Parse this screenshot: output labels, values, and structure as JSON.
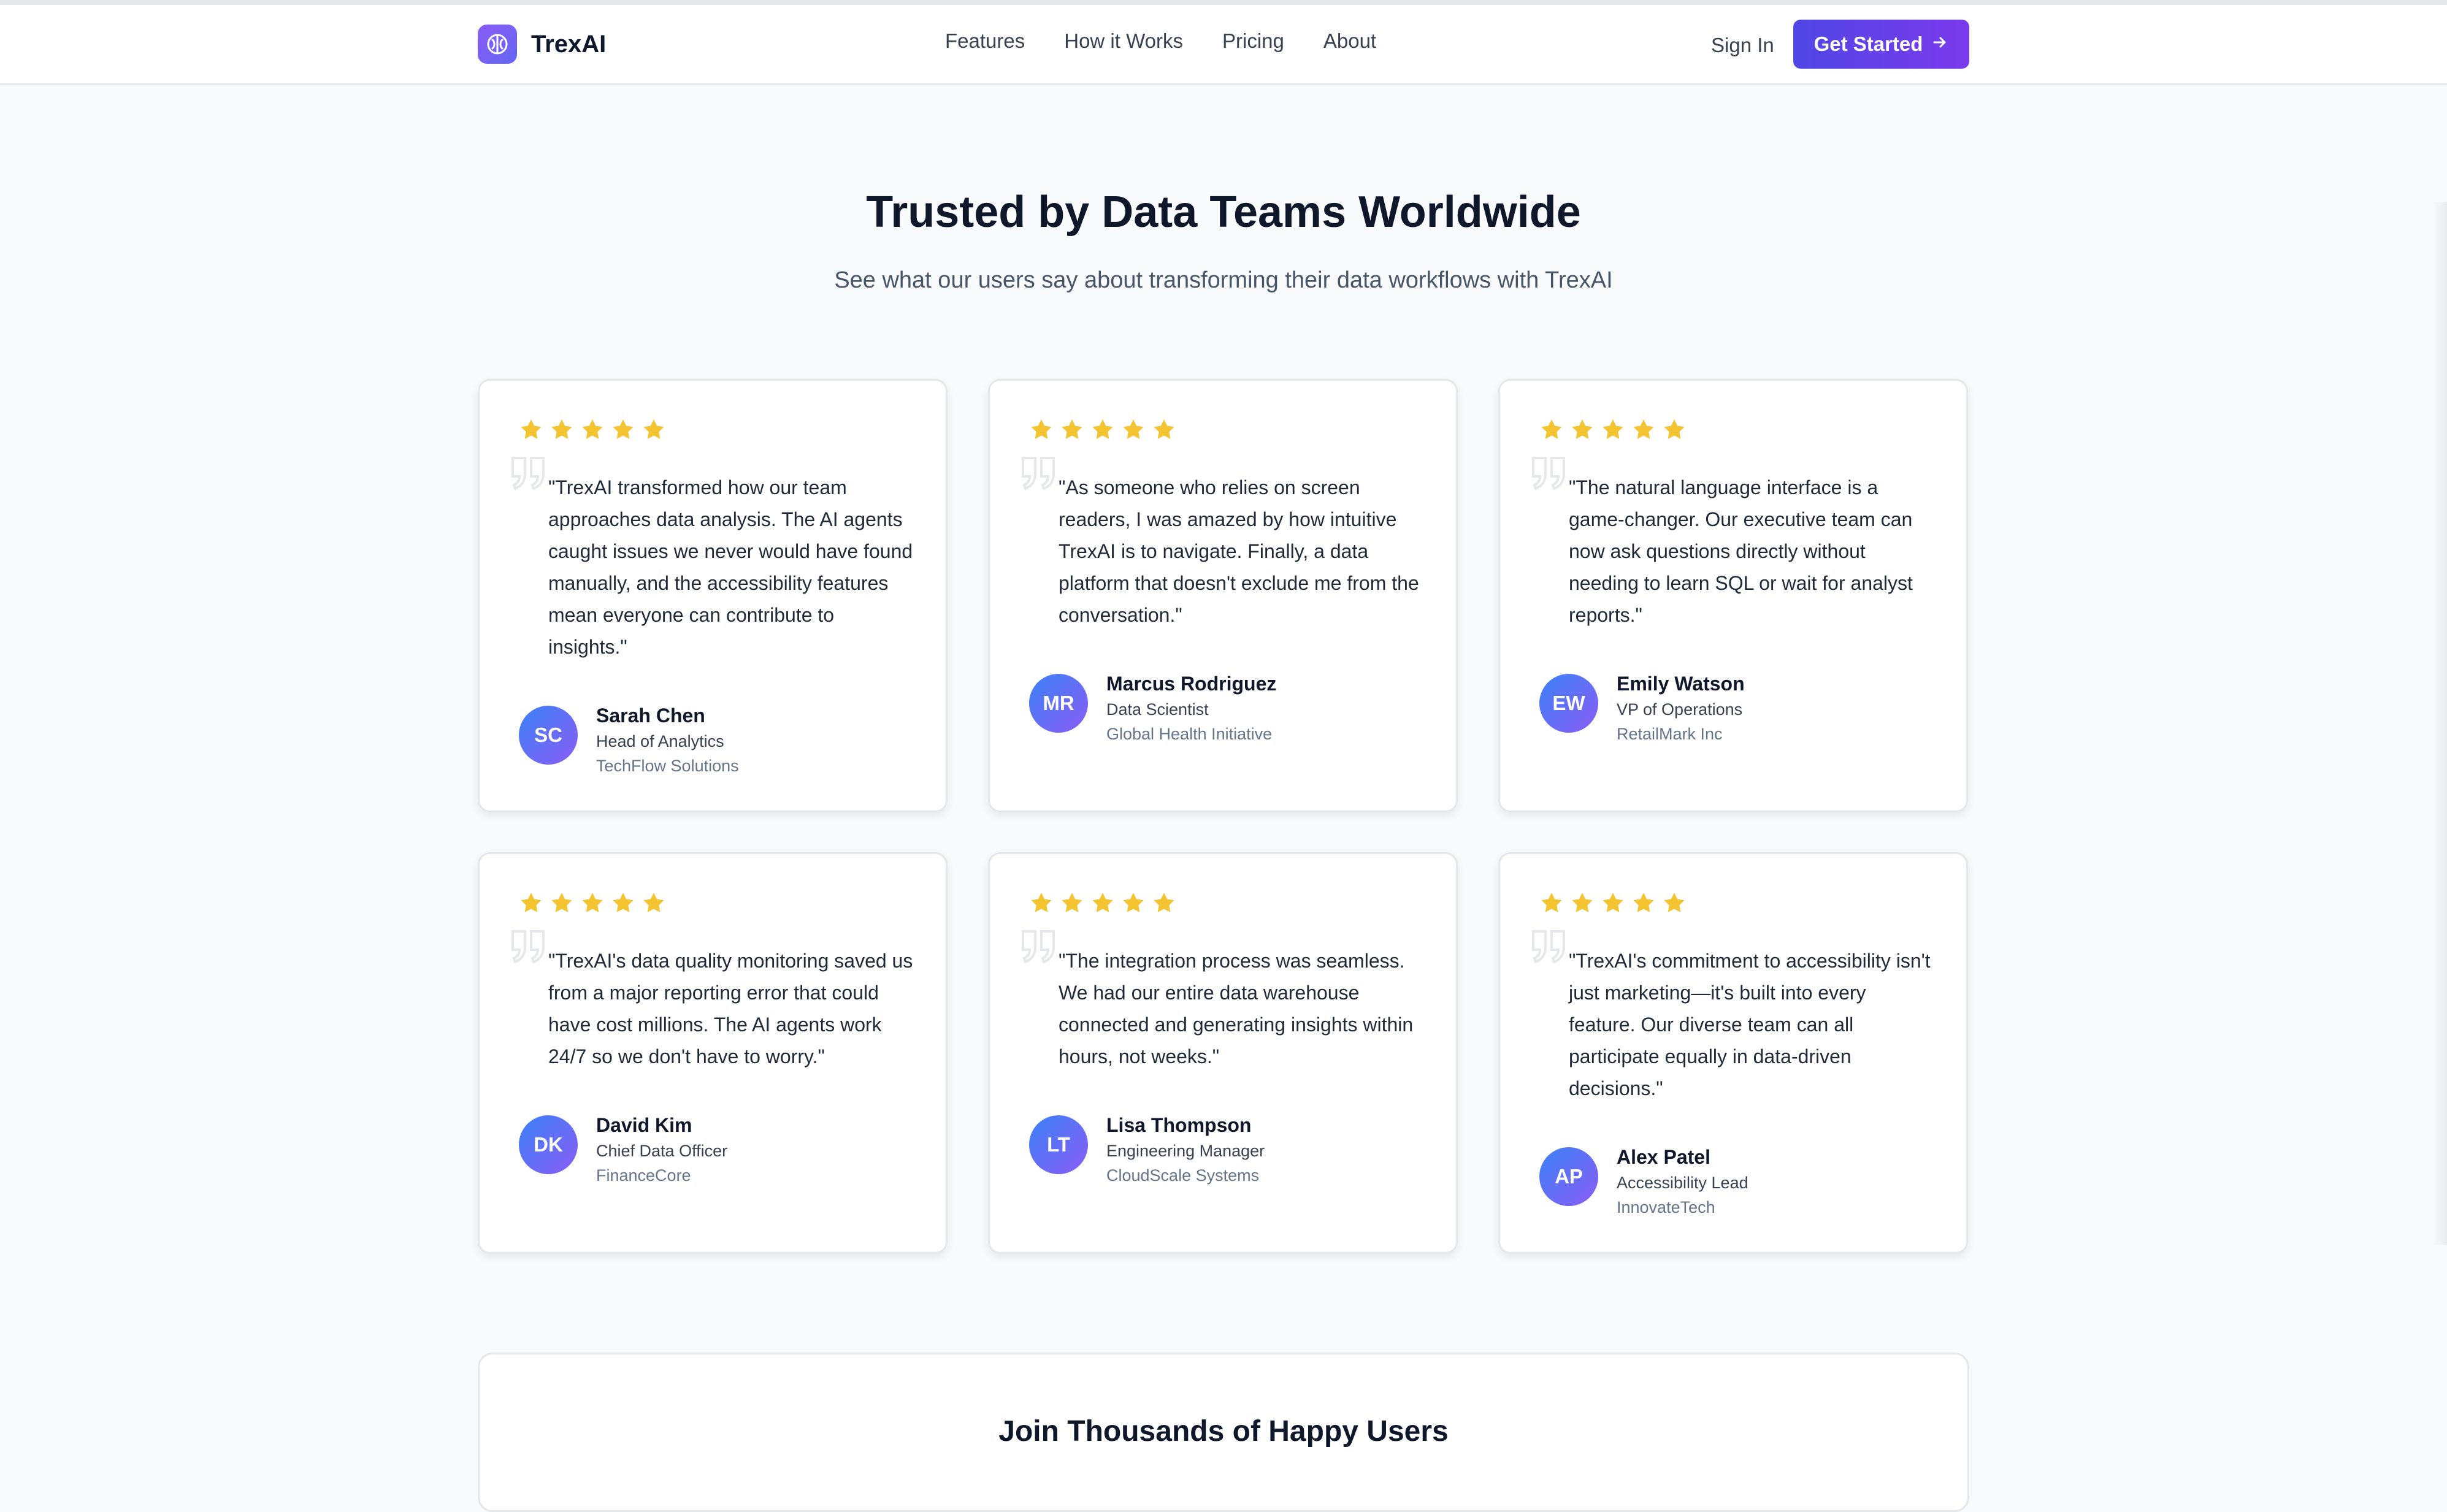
{
  "header": {
    "brand": "TrexAI",
    "nav": [
      "Features",
      "How it Works",
      "Pricing",
      "About"
    ],
    "sign_in": "Sign In",
    "get_started": "Get Started"
  },
  "section": {
    "title": "Trusted by Data Teams Worldwide",
    "subtitle": "See what our users say about transforming their data workflows with TrexAI"
  },
  "colors": {
    "accent": "#4f46e5",
    "accent2": "#7c3aed",
    "star": "#f4c430",
    "avatar_from": "#3b82f6",
    "avatar_to": "#8b5cf6"
  },
  "testimonials": [
    {
      "rating": 5,
      "quote": "\"TrexAI transformed how our team approaches data analysis. The AI agents caught issues we never would have found manually, and the accessibility features mean everyone can contribute to insights.\"",
      "initials": "SC",
      "name": "Sarah Chen",
      "role": "Head of Analytics",
      "company": "TechFlow Solutions"
    },
    {
      "rating": 5,
      "quote": "\"As someone who relies on screen readers, I was amazed by how intuitive TrexAI is to navigate. Finally, a data platform that doesn't exclude me from the conversation.\"",
      "initials": "MR",
      "name": "Marcus Rodriguez",
      "role": "Data Scientist",
      "company": "Global Health Initiative"
    },
    {
      "rating": 5,
      "quote": "\"The natural language interface is a game-changer. Our executive team can now ask questions directly without needing to learn SQL or wait for analyst reports.\"",
      "initials": "EW",
      "name": "Emily Watson",
      "role": "VP of Operations",
      "company": "RetailMark Inc"
    },
    {
      "rating": 5,
      "quote": "\"TrexAI's data quality monitoring saved us from a major reporting error that could have cost millions. The AI agents work 24/7 so we don't have to worry.\"",
      "initials": "DK",
      "name": "David Kim",
      "role": "Chief Data Officer",
      "company": "FinanceCore"
    },
    {
      "rating": 5,
      "quote": "\"The integration process was seamless. We had our entire data warehouse connected and generating insights within hours, not weeks.\"",
      "initials": "LT",
      "name": "Lisa Thompson",
      "role": "Engineering Manager",
      "company": "CloudScale Systems"
    },
    {
      "rating": 5,
      "quote": "\"TrexAI's commitment to accessibility isn't just marketing—it's built into every feature. Our diverse team can all participate equally in data-driven decisions.\"",
      "initials": "AP",
      "name": "Alex Patel",
      "role": "Accessibility Lead",
      "company": "InnovateTech"
    }
  ],
  "join": {
    "title": "Join Thousands of Happy Users"
  }
}
